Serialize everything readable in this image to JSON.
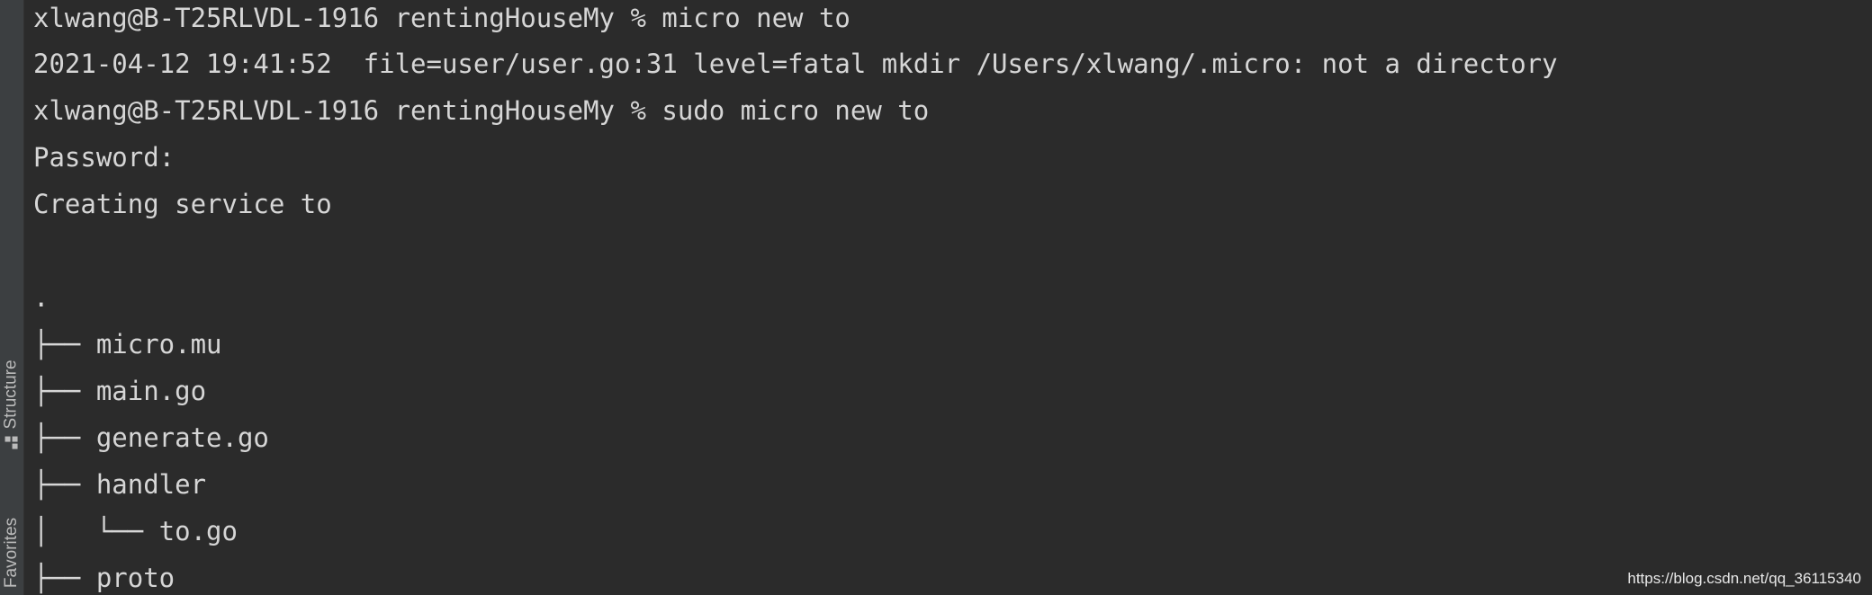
{
  "sidebar": {
    "structure_label": "Structure",
    "favorites_label": "Favorites",
    "structure_icon": "structure-icon"
  },
  "terminal": {
    "lines": [
      "xlwang@B-T25RLVDL-1916 rentingHouseMy % micro new to",
      "2021-04-12 19:41:52  file=user/user.go:31 level=fatal mkdir /Users/xlwang/.micro: not a directory",
      "xlwang@B-T25RLVDL-1916 rentingHouseMy % sudo micro new to",
      "Password:",
      "Creating service to",
      "",
      "",
      ".",
      "├── micro.mu",
      "├── main.go",
      "├── generate.go",
      "├── handler",
      "│   └── to.go",
      "├── proto"
    ]
  },
  "watermark": "https://blog.csdn.net/qq_36115340",
  "colors": {
    "background": "#2b2b2b",
    "text": "#d6d6d6",
    "sidebar": "#3c3f41"
  }
}
